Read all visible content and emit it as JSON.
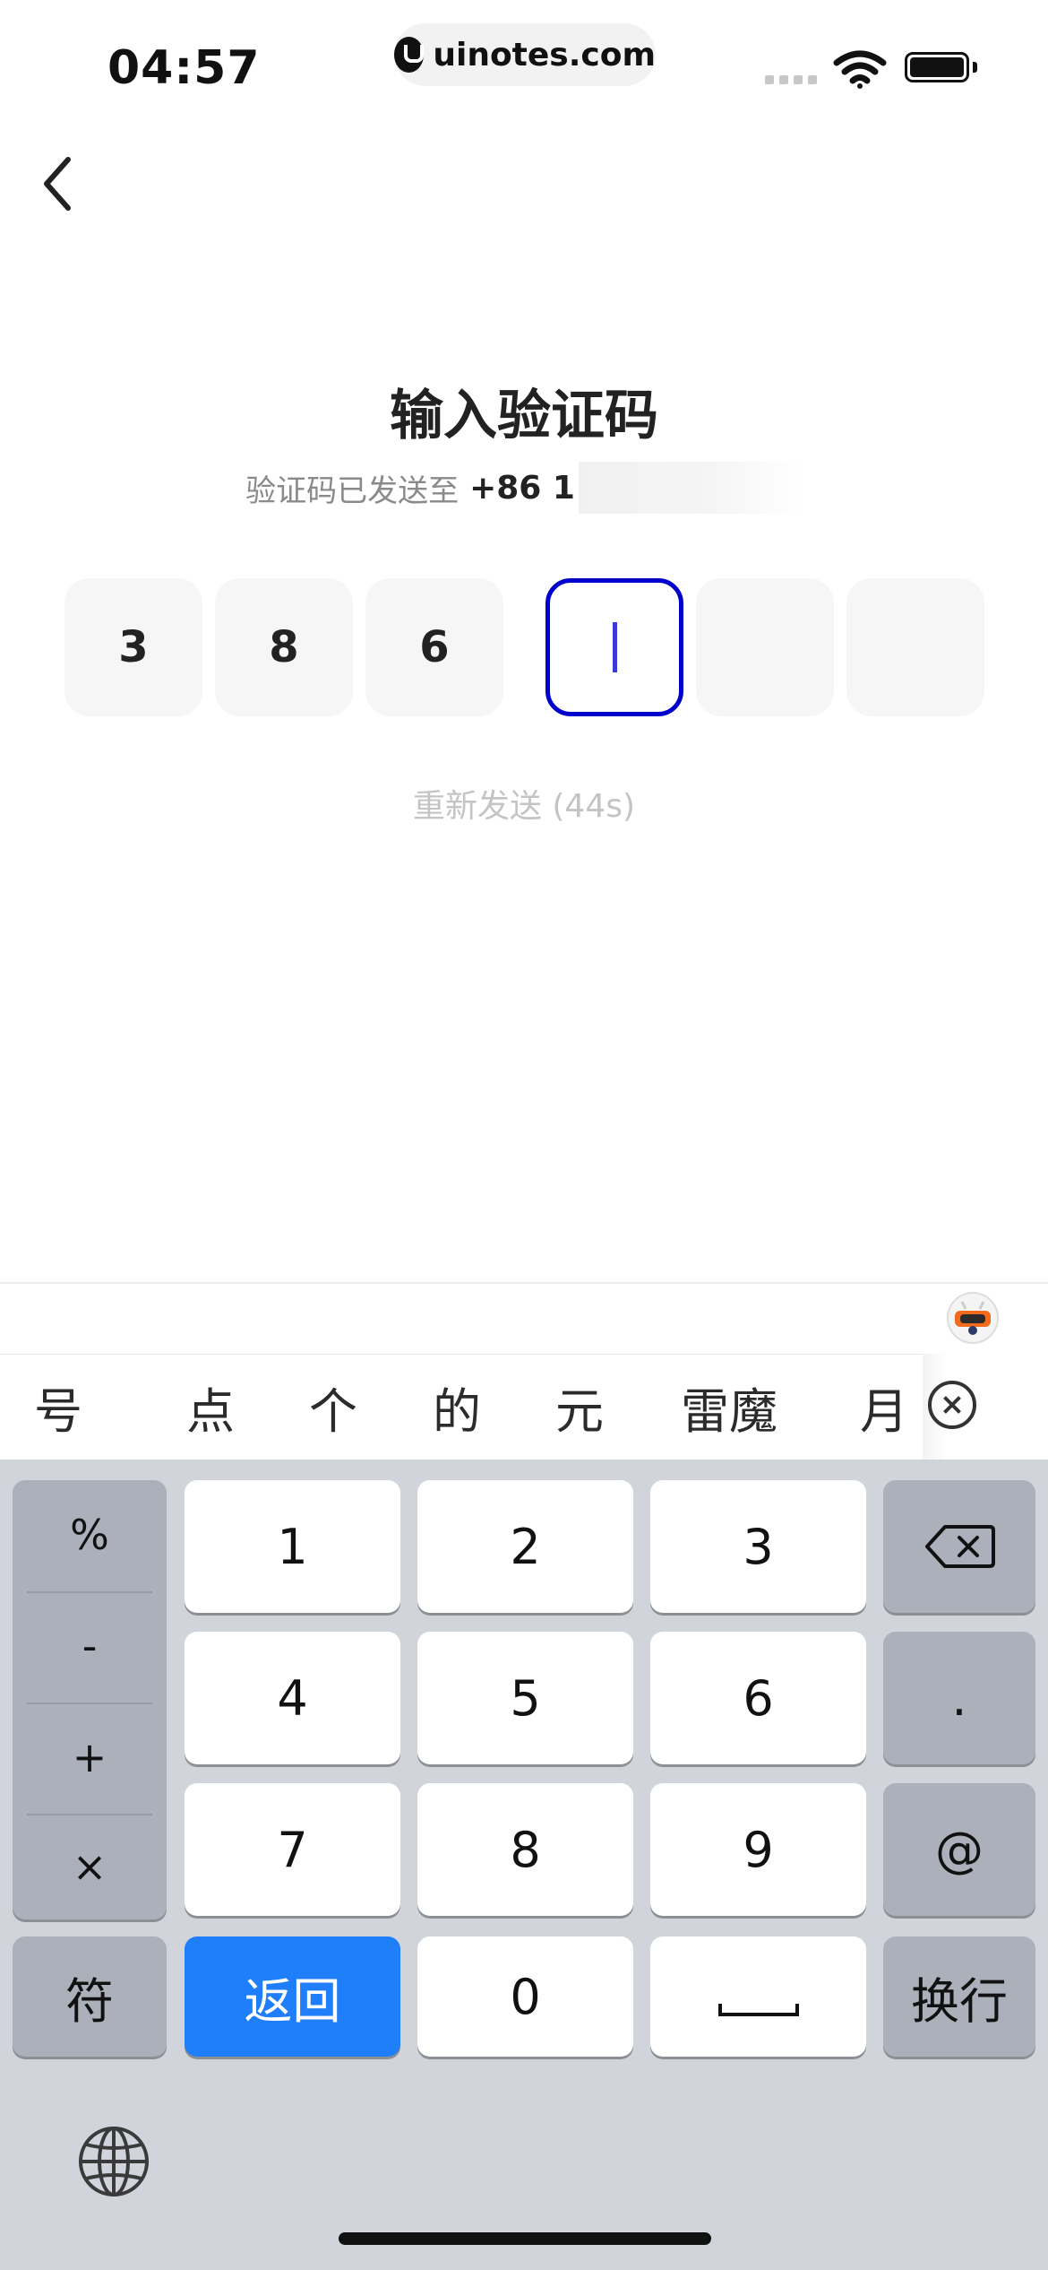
{
  "status_bar": {
    "time": "04:57",
    "url": "uinotes.com"
  },
  "screen": {
    "title": "输入验证码",
    "subtitle_prefix": "验证码已发送至",
    "phone_partial": "+86 1",
    "code_digits": [
      "3",
      "8",
      "6",
      "",
      "",
      ""
    ],
    "active_index": 3,
    "resend": "重新发送 (44s)"
  },
  "candidates": [
    "号",
    "点",
    "个",
    "的",
    "元",
    "雷魔",
    "月"
  ],
  "keyboard": {
    "symbols": [
      "%",
      "-",
      "+",
      "×"
    ],
    "digits_row1": [
      "1",
      "2",
      "3"
    ],
    "digits_row2": [
      "4",
      "5",
      "6"
    ],
    "digits_row3": [
      "7",
      "8",
      "9"
    ],
    "dot": ".",
    "at": "@",
    "fu": "符",
    "return_label": "返回",
    "zero": "0",
    "newline": "换行"
  },
  "colors": {
    "accent_blue": "#1f7ef9",
    "active_border": "#0000cc",
    "keyboard_bg": "#d1d4db"
  },
  "icons": [
    "back-arrow-icon",
    "wifi-icon",
    "battery-icon",
    "backspace-icon",
    "clear-candidates-icon",
    "globe-icon",
    "assistant-robot-icon"
  ]
}
